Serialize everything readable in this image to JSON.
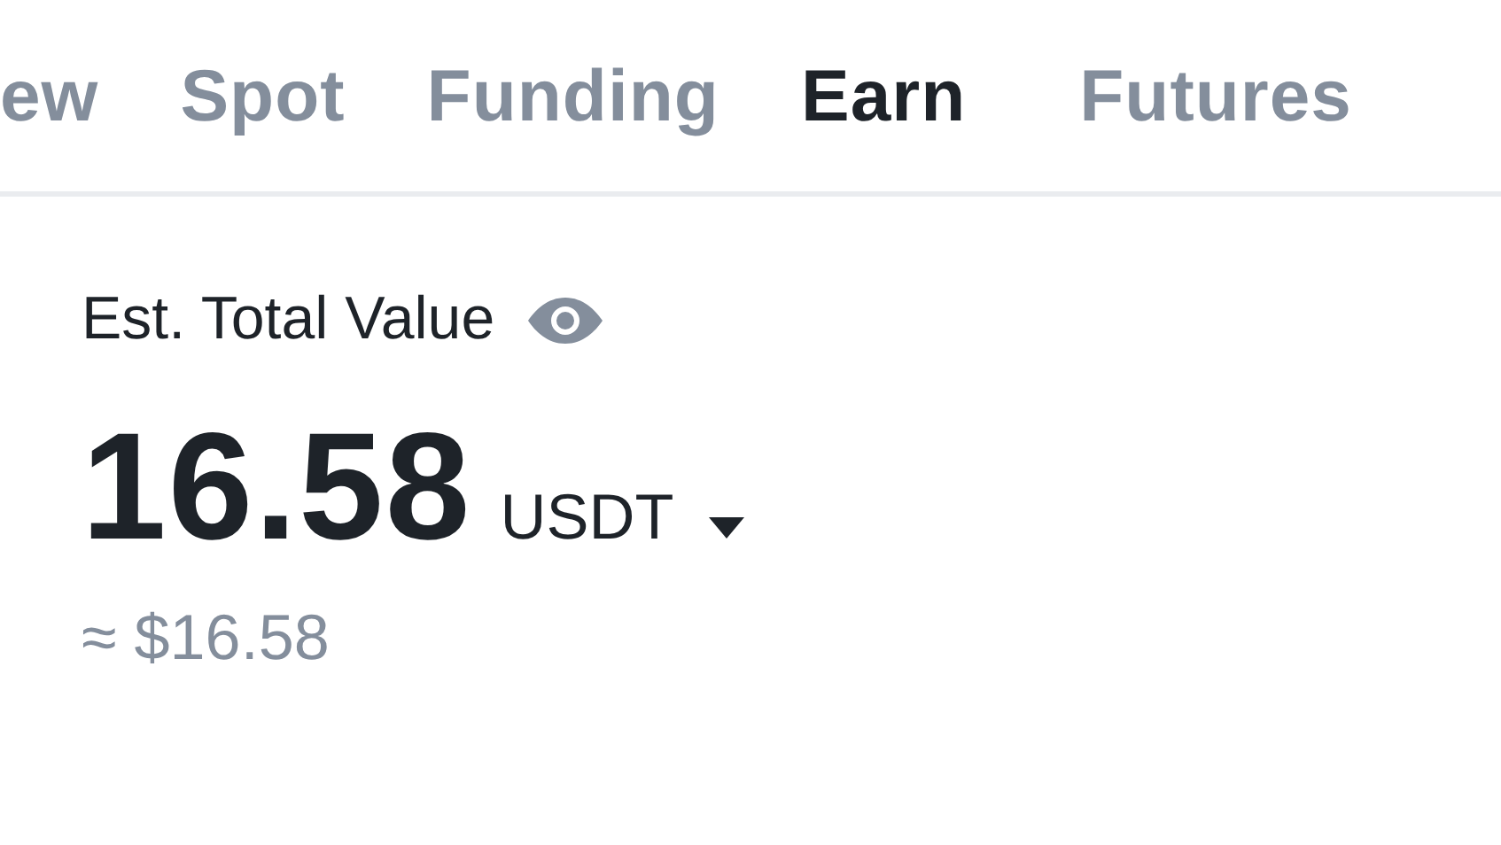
{
  "tabs": [
    {
      "label": "ew",
      "selected": false
    },
    {
      "label": "Spot",
      "selected": false
    },
    {
      "label": "Funding",
      "selected": false
    },
    {
      "label": "Earn",
      "selected": true
    },
    {
      "label": "Futures",
      "selected": false
    }
  ],
  "balance": {
    "label": "Est. Total Value",
    "amount": "16.58",
    "currency": "USDT",
    "fiat": "≈ $16.58"
  }
}
